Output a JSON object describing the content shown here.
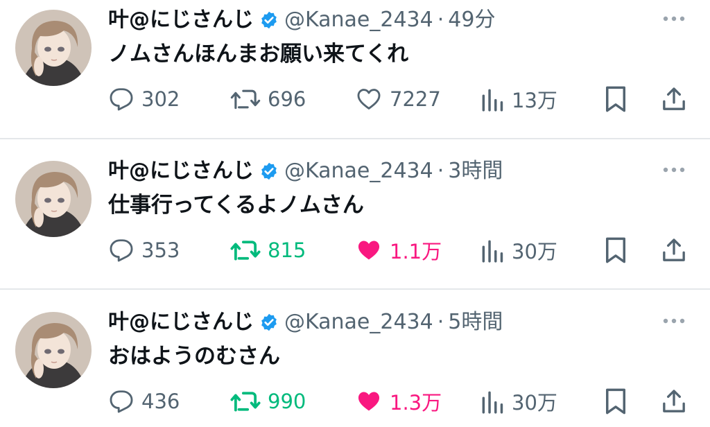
{
  "tweets": [
    {
      "name": "叶@にじさんじ",
      "handle": "@Kanae_2434",
      "separator": "·",
      "time": "49分",
      "text": "ノムさんほんまお願い来てくれ",
      "replies": "302",
      "retweets": "696",
      "likes": "7227",
      "views": "13万",
      "retweeted": false,
      "liked": false
    },
    {
      "name": "叶@にじさんじ",
      "handle": "@Kanae_2434",
      "separator": "·",
      "time": "3時間",
      "text": "仕事行ってくるよノムさん",
      "replies": "353",
      "retweets": "815",
      "likes": "1.1万",
      "views": "30万",
      "retweeted": true,
      "liked": true
    },
    {
      "name": "叶@にじさんじ",
      "handle": "@Kanae_2434",
      "separator": "·",
      "time": "5時間",
      "text": "おはようのむさん",
      "replies": "436",
      "retweets": "990",
      "likes": "1.3万",
      "views": "30万",
      "retweeted": true,
      "liked": true
    }
  ],
  "icons": {
    "verified": "verified-badge-icon",
    "more": "more-horizontal-icon",
    "reply": "reply-bubble-icon",
    "retweet": "retweet-icon",
    "like": "heart-icon",
    "views": "views-bar-chart-icon",
    "bookmark": "bookmark-icon",
    "share": "share-upload-icon"
  },
  "colors": {
    "text": "#0f1419",
    "secondary": "#536471",
    "verified": "#1d9bf0",
    "retweet_active": "#00ba7c",
    "like_active": "#f91880",
    "divider": "#e4e7ea"
  }
}
